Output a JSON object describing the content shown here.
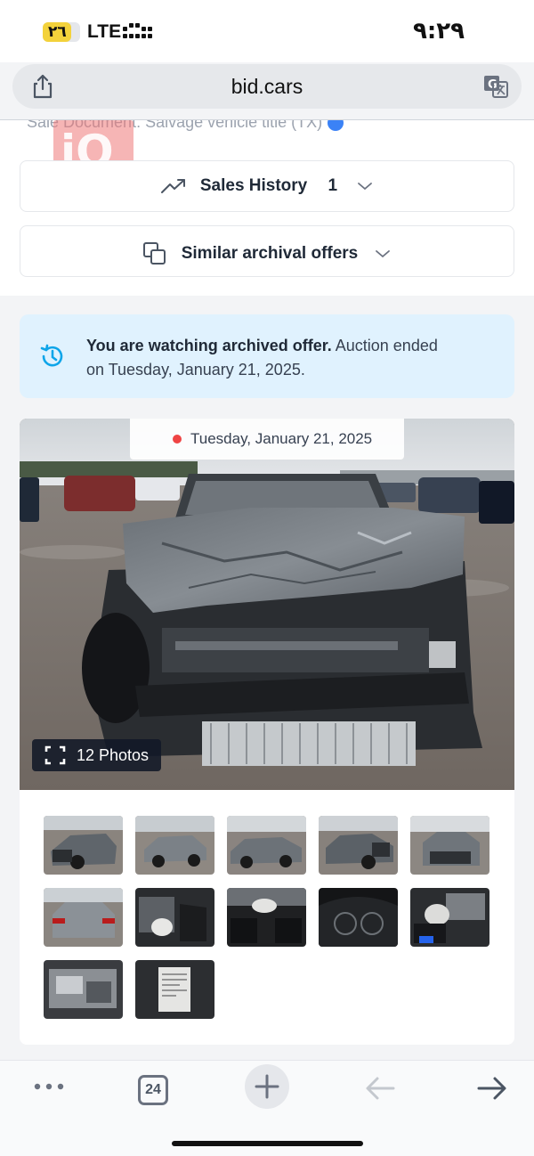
{
  "status_bar": {
    "battery": "٢٦",
    "network": "LTE",
    "time": "٩:٢٩"
  },
  "browser": {
    "url": "bid.cars",
    "tab_count": "24",
    "icons": [
      "share-icon",
      "translate-icon",
      "more-icon",
      "plus-icon",
      "back-arrow-icon",
      "forward-arrow-icon"
    ]
  },
  "page": {
    "sale_document_partial": "Sale Document:  Salvage vehicle title (TX)",
    "watermark": "iQ",
    "sales_history": {
      "label": "Sales History",
      "count": "1"
    },
    "similar_offers": {
      "label": "Similar archival offers"
    },
    "notice": {
      "bold": "You are watching archived offer.",
      "rest": " Auction ended on Tuesday, January 21, 2025."
    },
    "gallery": {
      "date": "Tuesday, January 21, 2025",
      "photos_label": "12 Photos",
      "thumbnail_count": 12
    }
  },
  "colors": {
    "accent_blue": "#0ea5e9",
    "notice_bg": "#e0f2fe",
    "status_red": "#ef4444"
  }
}
